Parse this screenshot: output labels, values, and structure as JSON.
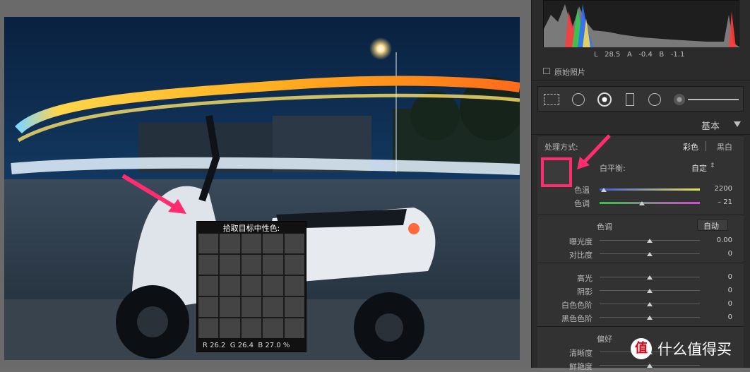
{
  "loupe": {
    "title": "拾取目标中性色:",
    "r_label": "R",
    "r_value": "26.2",
    "g_label": "G",
    "g_value": "26.4",
    "b_label": "B",
    "b_value": "27.0",
    "unit": "%"
  },
  "histogram": {
    "l_label": "L",
    "l_value": "28.5",
    "a_label": "A",
    "a_value": "-0.4",
    "b_label": "B",
    "b_value": "-1.1"
  },
  "original_photo_label": "原始照片",
  "basic_section": {
    "title": "基本",
    "treatment_label": "处理方式:",
    "treatment_color": "彩色",
    "treatment_bw": "黑白",
    "wb_label": "白平衡:",
    "wb_value": "自定",
    "temp_label": "色温",
    "temp_value": "2200",
    "temp_level": 0.03,
    "tint_label": "色调",
    "tint_value": "– 21",
    "tint_level": 0.41,
    "tone_label": "色调",
    "auto_label": "自动",
    "sliders_tone": [
      {
        "label": "曝光度",
        "value": "0.00",
        "level": 0.5
      },
      {
        "label": "对比度",
        "value": "0",
        "level": 0.5
      }
    ],
    "sliders_light": [
      {
        "label": "高光",
        "value": "0",
        "level": 0.5
      },
      {
        "label": "阴影",
        "value": "0",
        "level": 0.5
      },
      {
        "label": "白色色阶",
        "value": "0",
        "level": 0.5
      },
      {
        "label": "黑色色阶",
        "value": "0",
        "level": 0.5
      }
    ],
    "presence_label": "偏好",
    "sliders_presence": [
      {
        "label": "清晰度",
        "value": "",
        "level": 0.5
      },
      {
        "label": "鲜艳度",
        "value": "",
        "level": 0.5
      }
    ]
  },
  "watermark": {
    "text": "什么值得买"
  },
  "colors": {
    "accent_pink": "#ff2d6f",
    "panel_bg": "#2b2b2b",
    "temp_gradient_start": "#3e5bd8",
    "temp_gradient_end": "#e8e35a",
    "tint_gradient_start": "#39c245",
    "tint_gradient_end": "#d548d8"
  },
  "icons": [
    "crop-overlay-icon",
    "spot-removal-icon",
    "red-eye-icon",
    "graduated-filter-icon",
    "radial-filter-icon",
    "adjustment-brush-icon"
  ]
}
